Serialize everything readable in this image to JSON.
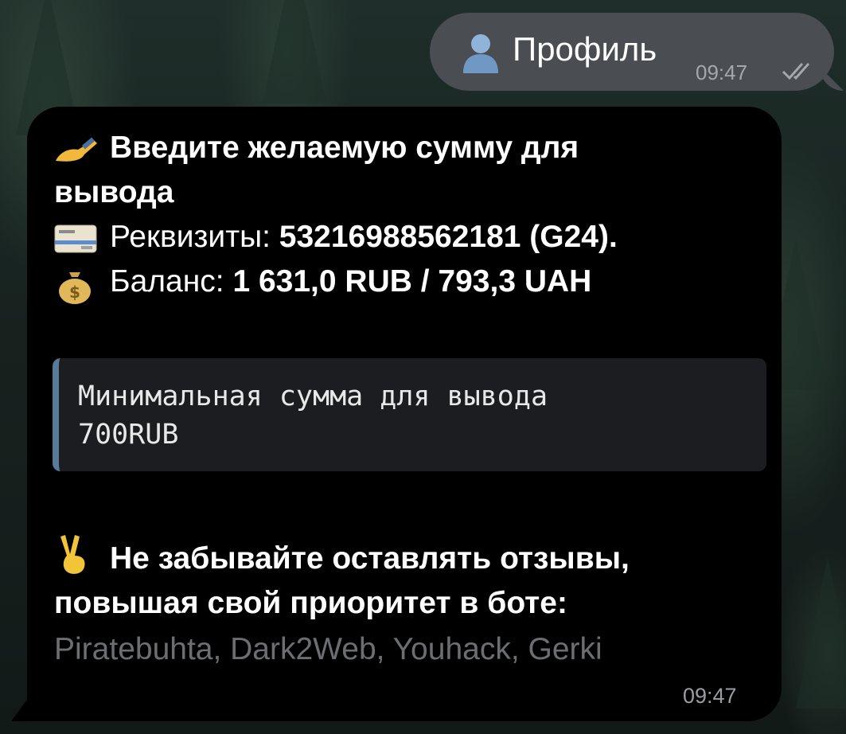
{
  "outgoing": {
    "icon": "user-silhouette-icon",
    "text": "Профиль",
    "time": "09:47",
    "status_icon": "double-check-icon"
  },
  "incoming": {
    "title_line1": "Введите желаемую сумму для",
    "title_line2": "вывода",
    "requisites_label": "Реквизиты: ",
    "requisites_value": "53216988562181 (G24).",
    "balance_label": "Баланс: ",
    "balance_value": "1 631,0 RUB  / 793,3 UAH",
    "quote_line1": "Минимальная сумма для вывода",
    "quote_line2": "700RUB",
    "reminder_line1": "Не забывайте оставлять отзывы,",
    "reminder_line2": "повышая свой приоритет в боте:",
    "sites": "Piratebuhta, Dark2Web, Youhack, Gerki",
    "time": "09:47",
    "icons": [
      "writing-hand-icon",
      "credit-card-icon",
      "money-bag-icon",
      "victory-hand-icon"
    ]
  }
}
